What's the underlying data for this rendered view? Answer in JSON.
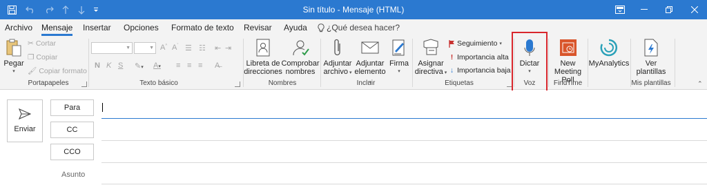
{
  "window": {
    "title": "Sin título  -  Mensaje (HTML)",
    "title_bar_color": "#2b79d0"
  },
  "quick_access": [
    "save-icon",
    "undo-icon",
    "redo-icon",
    "up-icon",
    "down-icon",
    "customize-icon"
  ],
  "tabs": [
    {
      "label": "Archivo"
    },
    {
      "label": "Mensaje",
      "active": true
    },
    {
      "label": "Insertar"
    },
    {
      "label": "Opciones"
    },
    {
      "label": "Formato de texto"
    },
    {
      "label": "Revisar"
    },
    {
      "label": "Ayuda"
    }
  ],
  "tell_me": "¿Qué desea hacer?",
  "ribbon": {
    "portapapeles": {
      "label": "Portapapeles",
      "pegar": "Pegar",
      "cortar": "Cortar",
      "copiar": "Copiar",
      "copiar_formato": "Copiar formato"
    },
    "texto_basico": {
      "label": "Texto básico",
      "bold": "N",
      "italic": "K",
      "underline": "S"
    },
    "nombres": {
      "label": "Nombres",
      "libreta_line1": "Libreta de",
      "libreta_line2": "direcciones",
      "comprobar_line1": "Comprobar",
      "comprobar_line2": "nombres"
    },
    "incluir": {
      "label": "Incluir",
      "adjuntar_archivo_line1": "Adjuntar",
      "adjuntar_archivo_line2": "archivo",
      "adjuntar_elemento_line1": "Adjuntar",
      "adjuntar_elemento_line2": "elemento",
      "firma": "Firma"
    },
    "etiquetas": {
      "label": "Etiquetas",
      "asignar_line1": "Asignar",
      "asignar_line2": "directiva",
      "seguimiento": "Seguimiento",
      "importancia_alta": "Importancia alta",
      "importancia_baja": "Importancia baja"
    },
    "voz": {
      "label": "Voz",
      "dictar": "Dictar"
    },
    "findtime": {
      "label": "FindTime",
      "new_line1": "New",
      "new_line2": "Meeting Poll"
    },
    "myanalytics": {
      "label": "MyAnalytics"
    },
    "mis_plantillas": {
      "label": "Mis plantillas",
      "ver_line1": "Ver",
      "ver_line2": "plantillas"
    }
  },
  "compose": {
    "send": "Enviar",
    "to": "Para",
    "cc": "CC",
    "bcc": "CCO",
    "subject": "Asunto"
  }
}
